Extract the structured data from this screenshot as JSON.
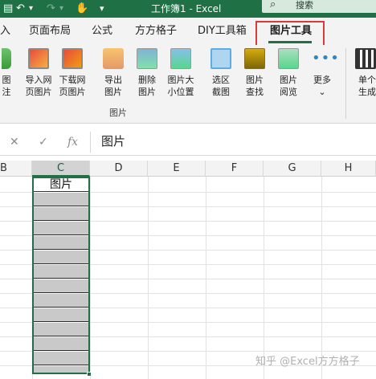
{
  "window": {
    "title": "工作簿1 - Excel",
    "search_placeholder": "搜索",
    "quick_access_icons": [
      "save-icon",
      "undo-icon",
      "redo-icon",
      "touch-mode-icon",
      "customize-icon"
    ],
    "quick_access_glyphs": {
      "save": "▤",
      "undo": "↶",
      "undo_dd": "▾",
      "redo": "↷",
      "redo_dd": "▾",
      "touch": "✋",
      "customize": "▾"
    }
  },
  "tabs": [
    {
      "label": "入",
      "active": false
    },
    {
      "label": "页面布局",
      "active": false
    },
    {
      "label": "公式",
      "active": false
    },
    {
      "label": "方方格子",
      "active": false
    },
    {
      "label": "DIY工具箱",
      "active": false
    },
    {
      "label": "图片工具",
      "active": true
    }
  ],
  "ribbon": {
    "group_label": "图片",
    "buttons": [
      {
        "label": "图\n注",
        "icon": "picture-annotate-icon"
      },
      {
        "label": "导入网\n页图片",
        "icon": "import-web-image-icon"
      },
      {
        "label": "下载网\n页图片",
        "icon": "download-web-image-icon"
      },
      {
        "label": "导出\n图片",
        "icon": "export-image-icon"
      },
      {
        "label": "删除\n图片",
        "icon": "delete-image-icon"
      },
      {
        "label": "图片大\n小位置",
        "icon": "image-size-position-icon"
      },
      {
        "label": "选区\n截图",
        "icon": "screenshot-selection-icon"
      },
      {
        "label": "图片\n查找",
        "icon": "image-find-icon"
      },
      {
        "label": "图片\n阅览",
        "icon": "image-preview-icon"
      },
      {
        "label": "更多\n⌄",
        "icon": "more-icon"
      },
      {
        "label": "单个\n生成",
        "icon": "qr-code-icon"
      }
    ]
  },
  "formula_bar": {
    "cancel": "✕",
    "confirm": "✓",
    "fx": "fx",
    "value": "图片"
  },
  "columns": [
    "B",
    "C",
    "D",
    "E",
    "F",
    "G",
    "H"
  ],
  "selected_column": "C",
  "cell_header_text": "图片",
  "watermark": "知乎 @Excel方方格子",
  "colors": {
    "accent": "#1f7044",
    "highlight_box": "#d93a3a",
    "cell_fill": "#c9c9c9"
  }
}
